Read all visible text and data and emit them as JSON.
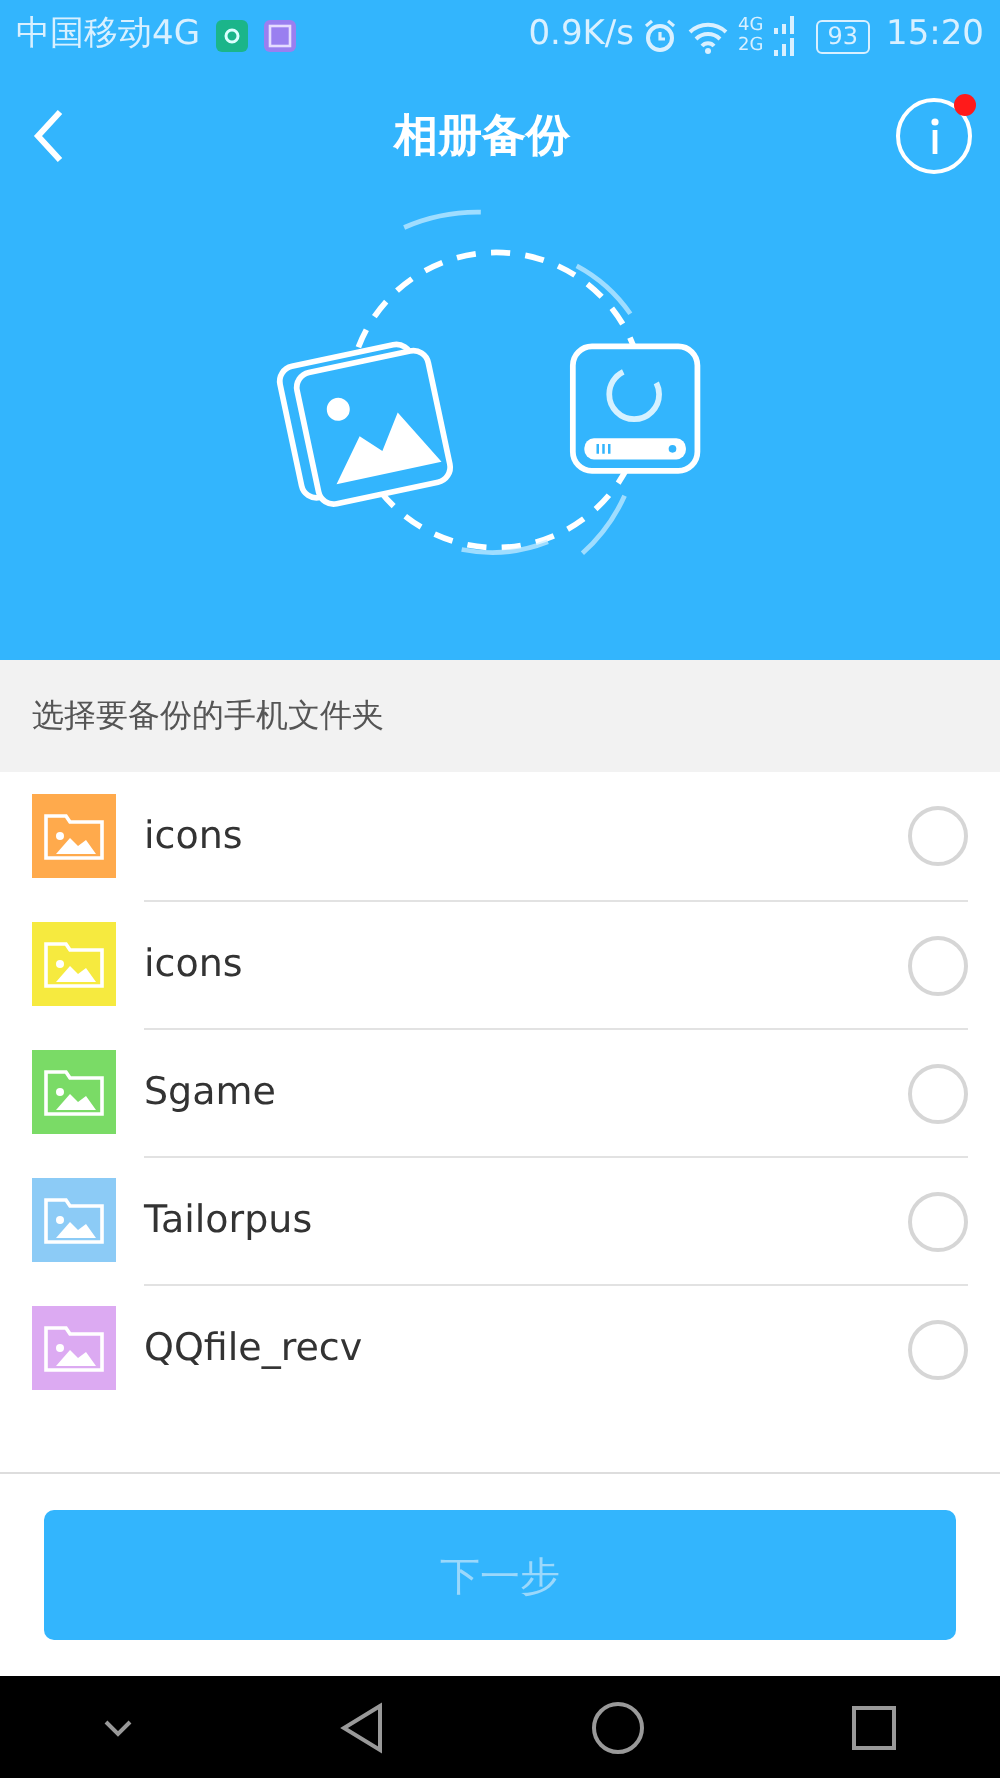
{
  "status_bar": {
    "carrier": "中国移动4G",
    "speed": "0.9K/s",
    "network_labels": [
      "4G",
      "2G"
    ],
    "battery": "93",
    "time": "15:20"
  },
  "header": {
    "title": "相册备份",
    "info_badge": true
  },
  "section_title": "选择要备份的手机文件夹",
  "folders": [
    {
      "name": "icons",
      "color": "#ffaa4c",
      "selected": false
    },
    {
      "name": "icons",
      "color": "#f6ea3f",
      "selected": false
    },
    {
      "name": "Sgame",
      "color": "#7adb66",
      "selected": false
    },
    {
      "name": "Tailorpus",
      "color": "#8ccbf6",
      "selected": false
    },
    {
      "name": "QQfile_recv",
      "color": "#dcaaf2",
      "selected": false
    }
  ],
  "next_button": {
    "label": "下一步",
    "disabled": true
  }
}
